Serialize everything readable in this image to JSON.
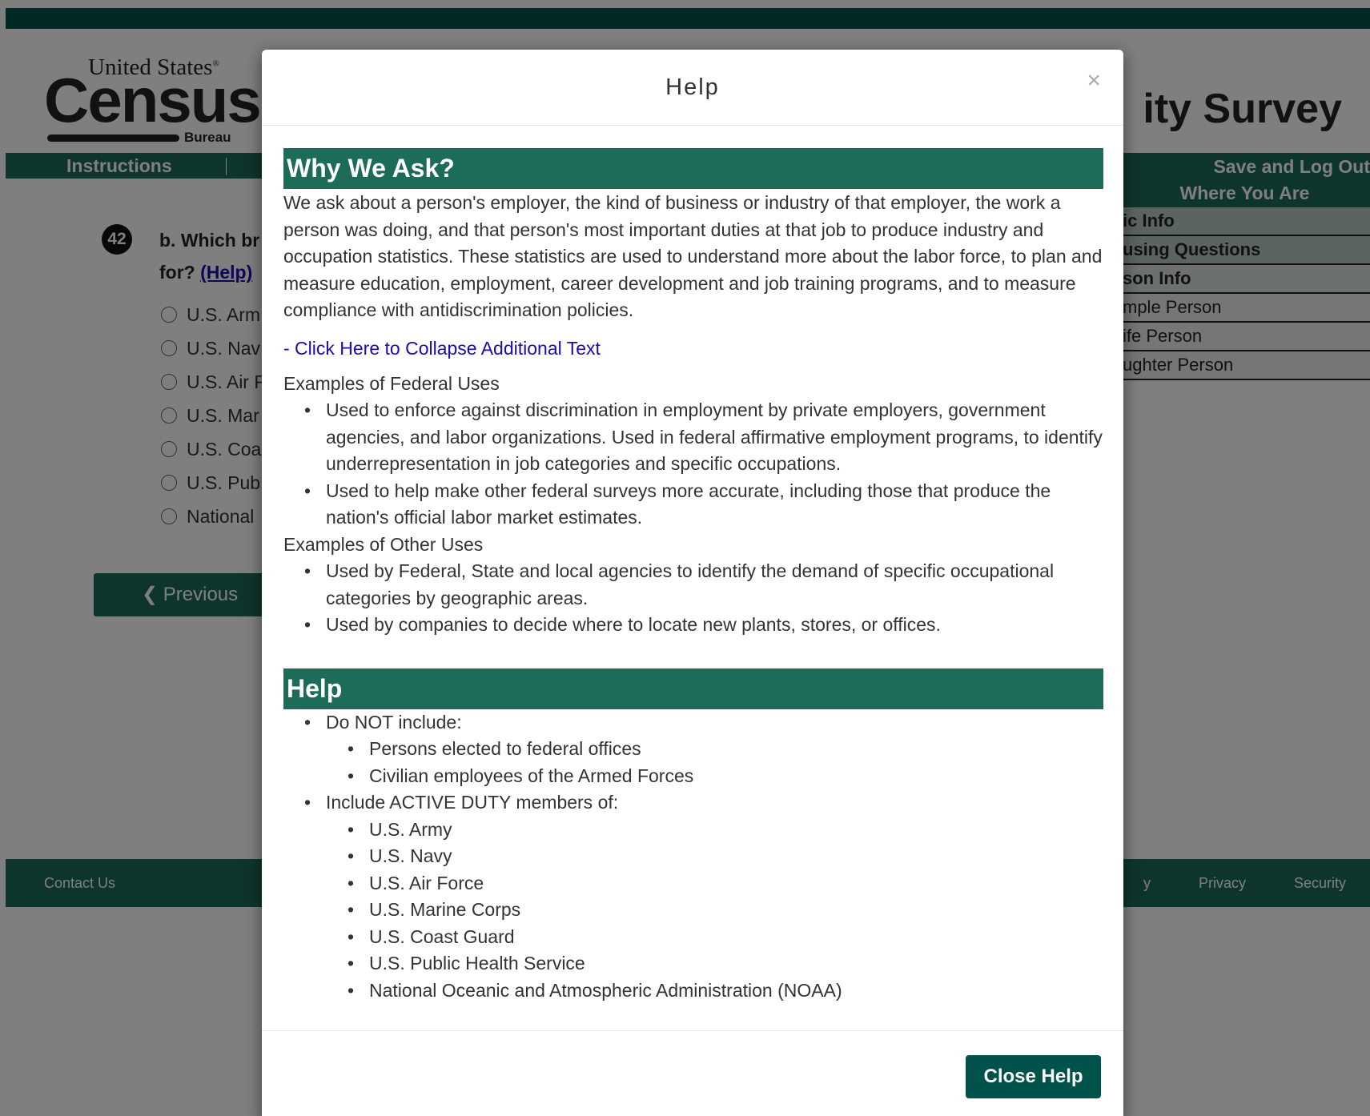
{
  "header": {
    "logo": {
      "united_states": "United States",
      "registered": "®",
      "census": "Census",
      "bureau": "Bureau"
    },
    "survey_title": "ity Survey"
  },
  "nav": {
    "instructions": "Instructions",
    "save_logout": "Save and Log Out"
  },
  "where_you_are": {
    "title": "Where You Are",
    "rows": [
      {
        "label": "ic Info",
        "kind": "section"
      },
      {
        "label": "using Questions",
        "kind": "section"
      },
      {
        "label": "son Info",
        "kind": "section-strong"
      },
      {
        "label": "mple Person",
        "kind": "person"
      },
      {
        "label": "ife Person",
        "kind": "person"
      },
      {
        "label": "ughter Person",
        "kind": "person"
      }
    ]
  },
  "question": {
    "number": "42",
    "text_line1": "b. Which br",
    "text_line2": "for?",
    "help_link": "(Help)",
    "options": [
      "U.S. Arm",
      "U.S. Nav",
      "U.S. Air F",
      "U.S. Mar",
      "U.S. Coa",
      "U.S. Pub",
      "National"
    ]
  },
  "previous_button": "Previous",
  "footer": {
    "contact": "Contact Us",
    "right_links": [
      "y",
      "Privacy",
      "Security"
    ]
  },
  "modal": {
    "title": "Help",
    "close_symbol": "×",
    "why_heading": "Why We Ask?",
    "why_paragraph": "We ask about a person's employer, the kind of business or industry of that employer, the work a person was doing, and that person's most important duties at that job to produce industry and occupation statistics. These statistics are used to understand more about the labor force, to plan and measure education, employment, career development and job training programs, and to measure compliance with antidiscrimination policies.",
    "collapse_link": "- Click Here to Collapse Additional Text",
    "federal_heading": "Examples of Federal Uses",
    "federal_uses": [
      "Used to enforce against discrimination in employment by private employers, government agencies, and labor organizations. Used in federal affirmative employment programs, to identify underrepresentation in job categories and specific occupations.",
      "Used to help make other federal surveys more accurate, including those that produce the nation's official labor market estimates."
    ],
    "other_heading": "Examples of Other Uses",
    "other_uses": [
      "Used by Federal, State and local agencies to identify the demand of specific occupational categories by geographic areas.",
      "Used by companies to decide where to locate new plants, stores, or offices."
    ],
    "help_heading": "Help",
    "do_not_label": "Do NOT include:",
    "do_not_items": [
      "Persons elected to federal offices",
      "Civilian employees of the Armed Forces"
    ],
    "include_label": "Include ACTIVE DUTY members of:",
    "include_items": [
      "U.S. Army",
      "U.S. Navy",
      "U.S. Air Force",
      "U.S. Marine Corps",
      "U.S. Coast Guard",
      "U.S. Public Health Service",
      "National Oceanic and Atmospheric Administration (NOAA)"
    ],
    "close_button": "Close Help"
  }
}
